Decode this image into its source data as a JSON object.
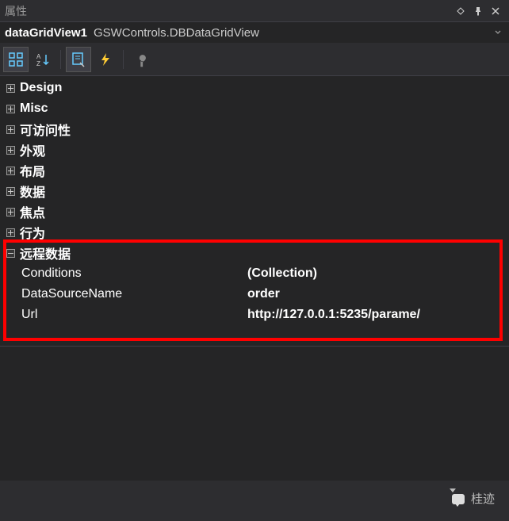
{
  "panel": {
    "title": "属性"
  },
  "selector": {
    "control_name": "dataGridView1",
    "control_type": "GSWControls.DBDataGridView"
  },
  "categories": [
    {
      "label": "Design",
      "expanded": false
    },
    {
      "label": "Misc",
      "expanded": false
    },
    {
      "label": "可访问性",
      "expanded": false
    },
    {
      "label": "外观",
      "expanded": false
    },
    {
      "label": "布局",
      "expanded": false
    },
    {
      "label": "数据",
      "expanded": false
    },
    {
      "label": "焦点",
      "expanded": false
    },
    {
      "label": "行为",
      "expanded": false
    },
    {
      "label": "远程数据",
      "expanded": true,
      "props": [
        {
          "name": "Conditions",
          "value": "(Collection)"
        },
        {
          "name": "DataSourceName",
          "value": "order"
        },
        {
          "name": "Url",
          "value": "http://127.0.0.1:5235/parame/"
        }
      ]
    }
  ],
  "watermark": {
    "label": "桂迹"
  }
}
